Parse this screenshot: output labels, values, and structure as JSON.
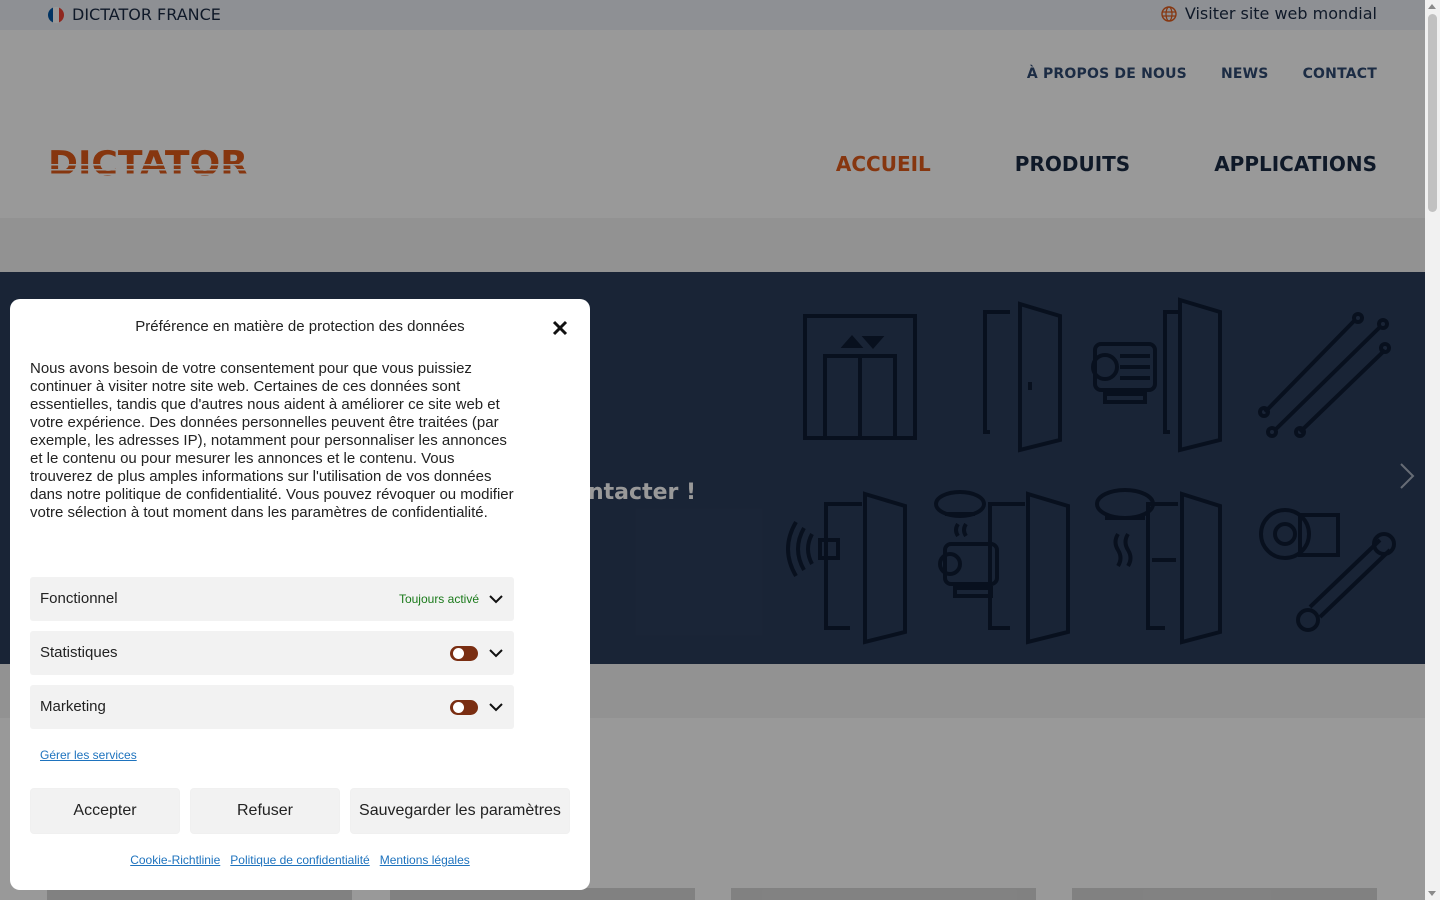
{
  "topbar": {
    "country": "DICTATOR FRANCE",
    "world_link": "Visiter site web mondial",
    "flag_colors": [
      "#0055a4",
      "#ffffff",
      "#ef4135"
    ]
  },
  "subnav": [
    "À PROPOS DE NOUS",
    "NEWS",
    "CONTACT"
  ],
  "logo": {
    "text": "DICTATOR",
    "color": "#e05a1a"
  },
  "mainnav": {
    "items": [
      "ACCUEIL",
      "PRODUITS",
      "APPLICATIONS"
    ],
    "active_color": "#e05a1a"
  },
  "hero": {
    "visible_text": "ntacter !"
  },
  "cookie_modal": {
    "title": "Préférence en matière de protection des données",
    "body": "Nous avons besoin de votre consentement pour que vous puissiez continuer à visiter notre site web. Certaines de ces données sont essentielles, tandis que d'autres nous aident à améliorer ce site web et votre expérience. Des données personnelles peuvent être traitées (par exemple, les adresses IP), notamment pour personnaliser les annonces et le contenu ou pour mesurer les annonces et le contenu. Vous trouverez de plus amples informations sur l'utilisation de vos données dans notre politique de confidentialité. Vous pouvez révoquer ou modifier votre sélection à tout moment dans les paramètres de confidentialité.",
    "categories": [
      {
        "label": "Fonctionnel",
        "status": "Toujours activé"
      },
      {
        "label": "Statistiques",
        "enabled": false
      },
      {
        "label": "Marketing",
        "enabled": false
      }
    ],
    "manage_services": "Gérer les services",
    "buttons": {
      "accept": "Accepter",
      "refuse": "Refuser",
      "save": "Sauvegarder les paramètres"
    },
    "footer_links": [
      "Cookie-Richtlinie",
      "Politique de confidentialité",
      "Mentions légales"
    ],
    "toggle_color": "#7a2e12",
    "always_on_color": "#1a7a1a"
  }
}
